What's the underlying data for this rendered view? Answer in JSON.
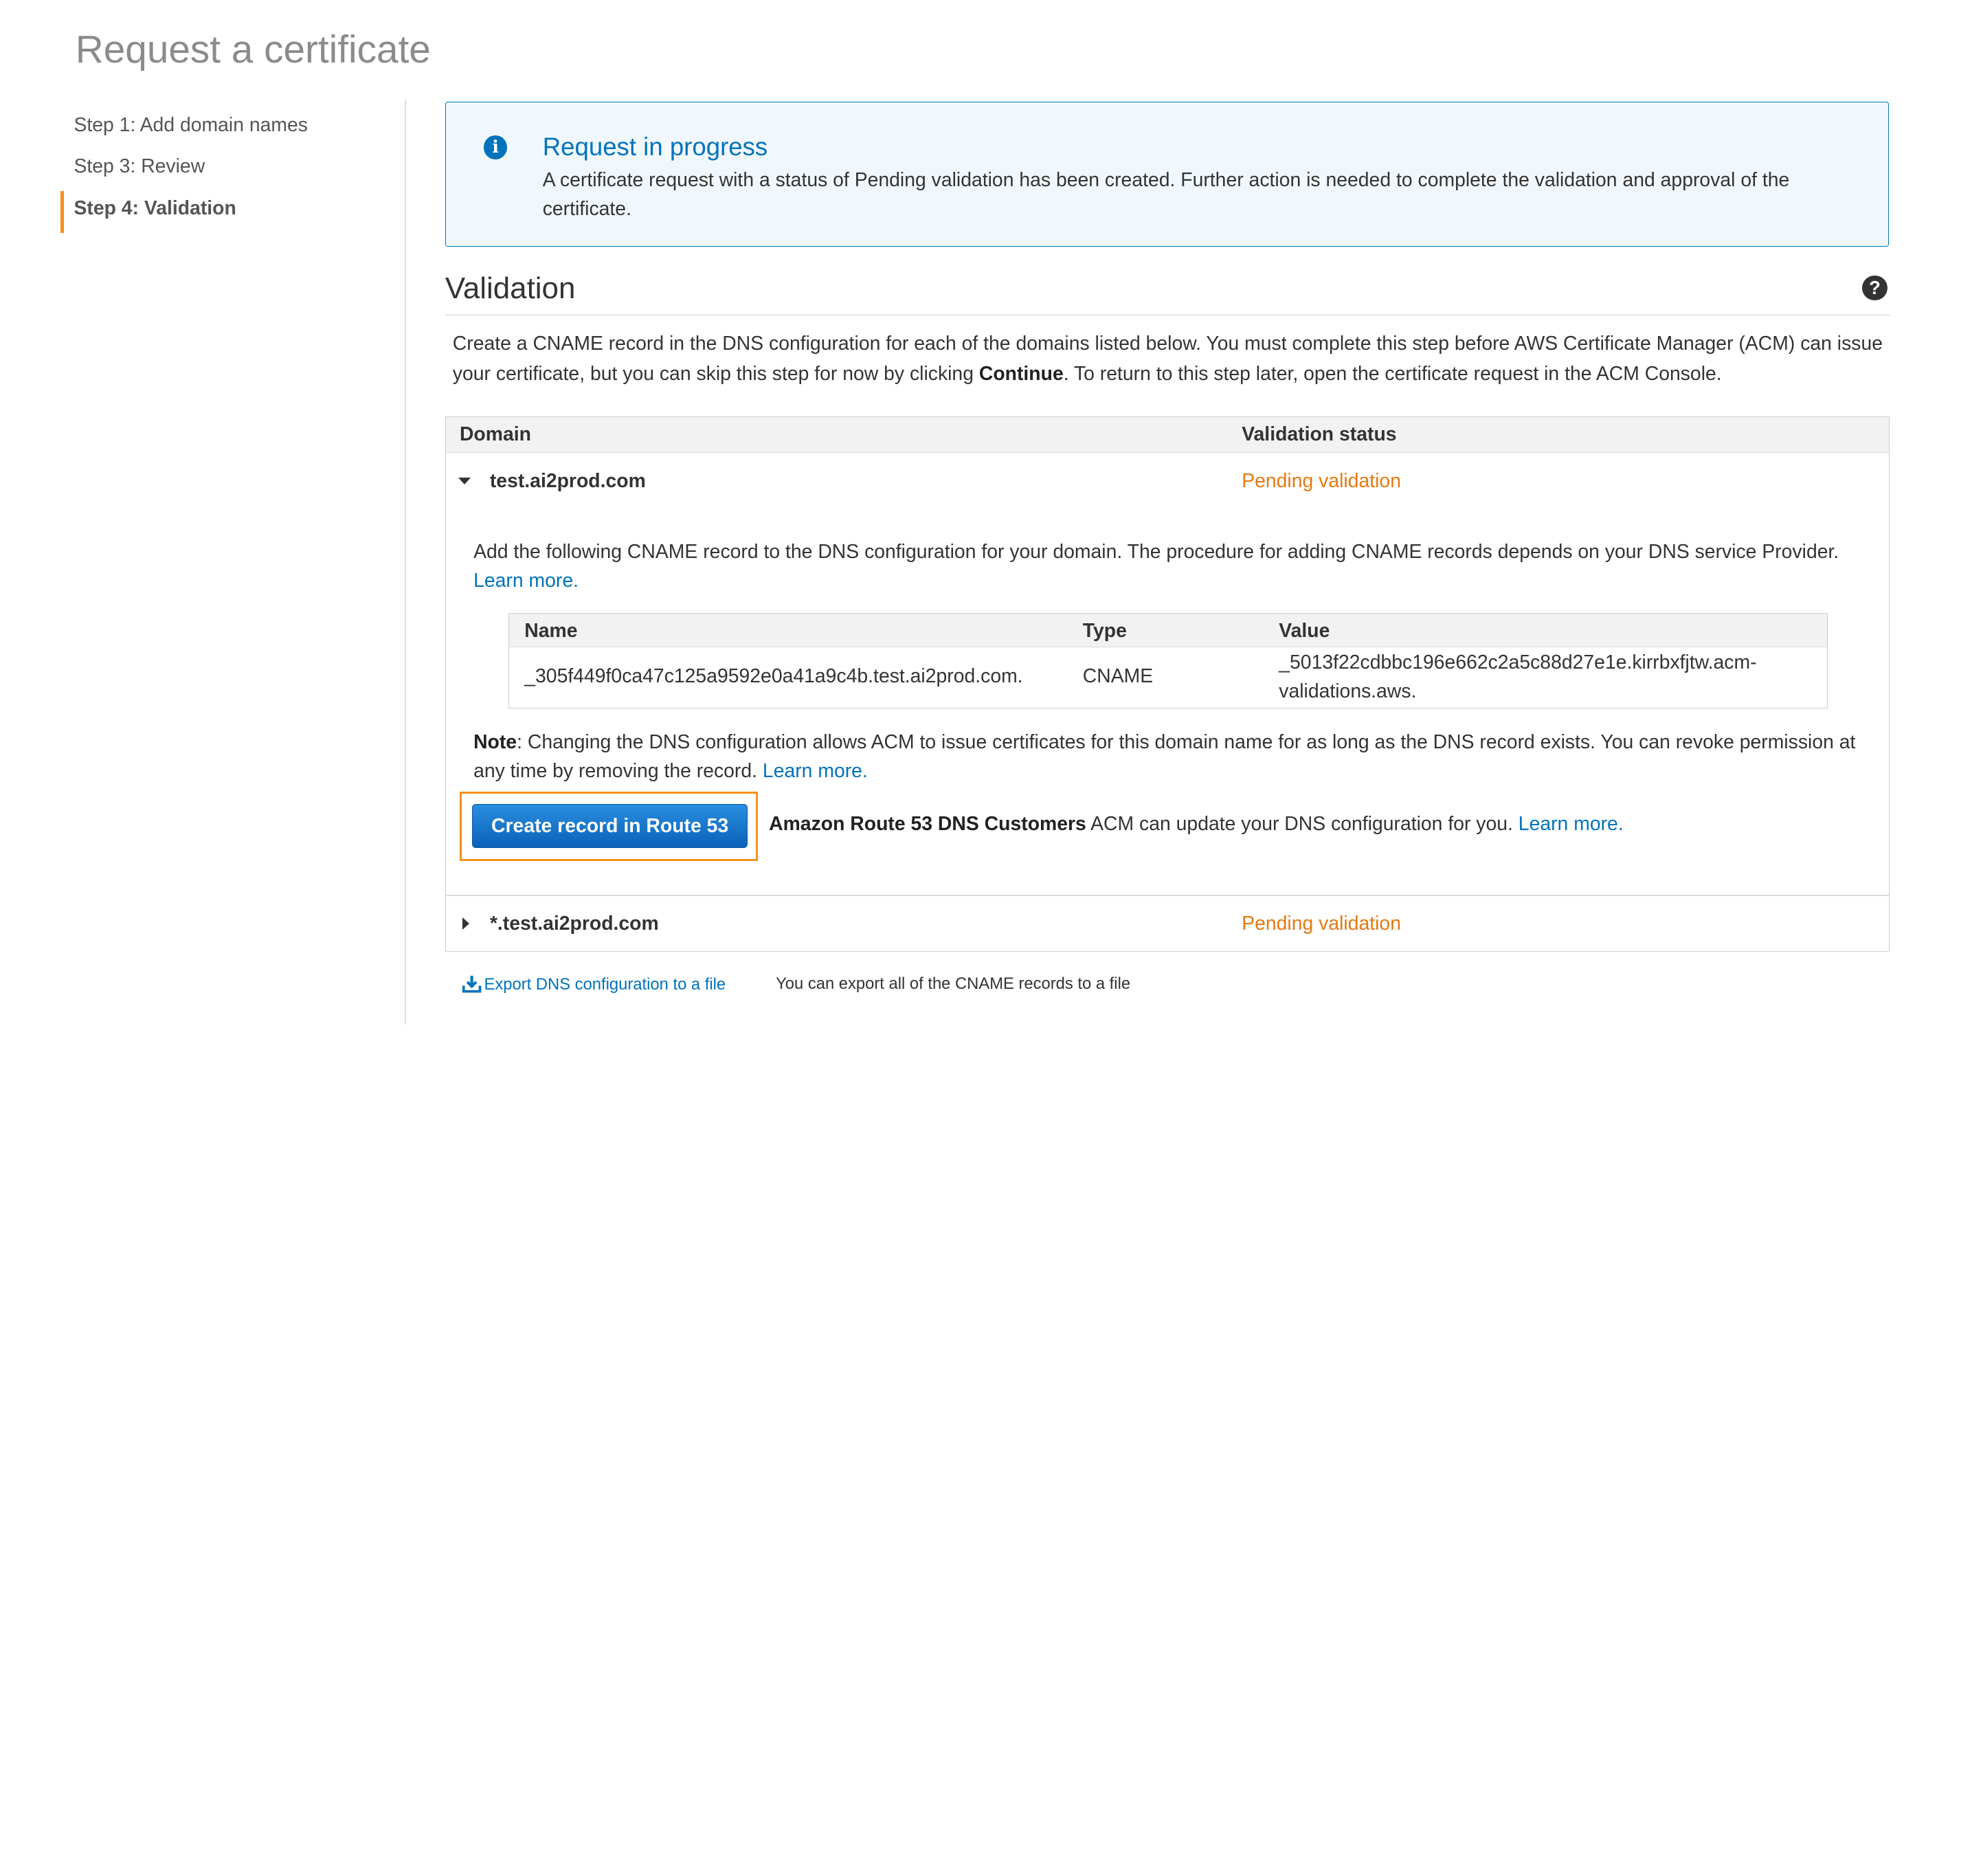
{
  "page": {
    "title": "Request a certificate"
  },
  "steps": [
    {
      "label": "Step 1: Add domain names",
      "active": false
    },
    {
      "label": "Step 3: Review",
      "active": false
    },
    {
      "label": "Step 4: Validation",
      "active": true
    }
  ],
  "alert": {
    "icon": "info-icon",
    "title": "Request in progress",
    "body": "A certificate request with a status of Pending validation has been created. Further action is needed to complete the validation and approval of the certificate."
  },
  "validation": {
    "title": "Validation",
    "help_icon": "question-icon",
    "desc_part1": "Create a CNAME record in the DNS configuration for each of the domains listed below. You must complete this step before AWS Certificate Manager (ACM) can issue your certificate, but you can skip this step for now by clicking ",
    "desc_bold": "Continue",
    "desc_part2": ". To return to this step later, open the certificate request in the ACM Console."
  },
  "table": {
    "headers": {
      "domain": "Domain",
      "status": "Validation status"
    },
    "rows": [
      {
        "domain": "test.ai2prod.com",
        "status": "Pending validation",
        "expanded": true
      },
      {
        "domain": "*.test.ai2prod.com",
        "status": "Pending validation",
        "expanded": false
      }
    ],
    "expanded": {
      "instructions": "Add the following CNAME record to the DNS configuration for your domain. The procedure for adding CNAME records depends on your DNS service Provider.",
      "learn_more": "Learn more.",
      "cname_headers": {
        "name": "Name",
        "type": "Type",
        "value": "Value"
      },
      "cname_record": {
        "name": "_305f449f0ca47c125a9592e0a41a9c4b.test.ai2prod.com.",
        "type": "CNAME",
        "value_line1": "_5013f22cdbbc196e662c2a5c88d27e1e.kirrbxfjtw.acm-",
        "value_line2": "validations.aws."
      },
      "note_label": "Note",
      "note_text": ": Changing the DNS configuration allows ACM to issue certificates for this domain name for as long as the DNS record exists. You can revoke permission at any time by removing the record. ",
      "note_learn_more": "Learn more.",
      "route53_button": "Create record in Route 53",
      "route53_bold": "Amazon Route 53 DNS Customers",
      "route53_text": " ACM can update your DNS configuration for you. ",
      "route53_learn_more": "Learn more."
    }
  },
  "export": {
    "link": "Export DNS configuration to a file",
    "note": "You can export all of the CNAME records to a file"
  },
  "colors": {
    "accent": "#0073bb",
    "pending": "#e47911",
    "highlight": "#f5911e"
  }
}
